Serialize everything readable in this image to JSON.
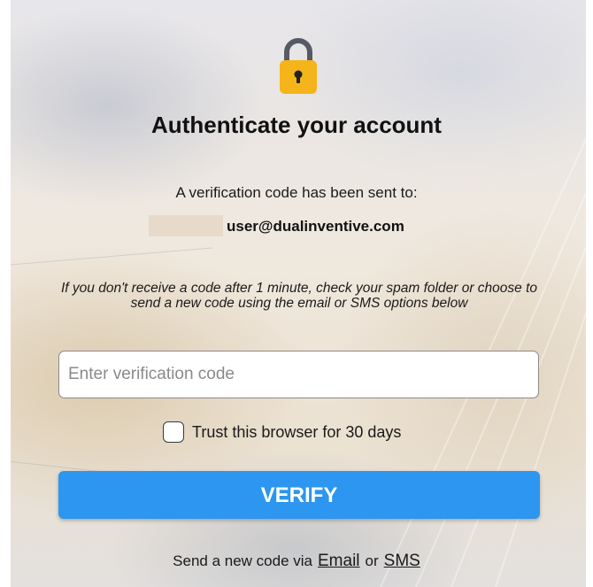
{
  "title": "Authenticate your account",
  "verification": {
    "sent_to_text": "A verification code has been sent to:",
    "email": "user@dualinventive.com",
    "hint": "If you don't receive a code after 1 minute, check your spam folder or choose to send a new code using the email or SMS options below"
  },
  "code_input": {
    "placeholder": "Enter verification code",
    "value": ""
  },
  "trust": {
    "label": "Trust this browser for 30 days",
    "checked": false
  },
  "verify_button": {
    "label": "VERIFY",
    "color": "#2c96f0"
  },
  "resend": {
    "prefix": "Send a new code via",
    "email_link": "Email",
    "or": "or",
    "sms_link": "SMS"
  },
  "icons": {
    "lock": "padlock-icon",
    "lock_color": "#f5b41a",
    "shackle_color": "#565a63"
  }
}
